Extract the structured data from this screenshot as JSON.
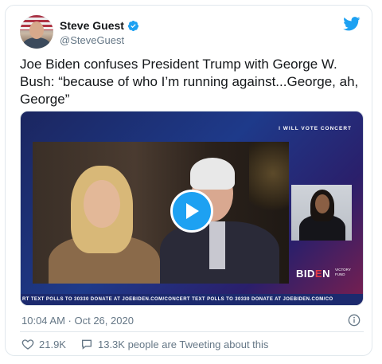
{
  "author": {
    "display_name": "Steve Guest",
    "handle": "@SteveGuest",
    "verified": true
  },
  "tweet": {
    "text": "Joe Biden confuses President Trump with George W. Bush: “because of who I’m running against...George, ah, George”",
    "timestamp": "10:04 AM · Oct 26, 2020"
  },
  "media": {
    "overlay_label": "I WILL VOTE CONCERT",
    "logo_text": "BID",
    "logo_bar": "E",
    "logo_end": "N",
    "logo_sub": "VICTORY FUND",
    "ticker": "RT   TEXT POLLS TO 30330   DONATE AT JOEBIDEN.COM/CONCERT   TEXT POLLS TO 30330   DONATE AT JOEBIDEN.COM/CO"
  },
  "actions": {
    "likes": "21.9K",
    "tweeting": "13.3K people are Tweeting about this"
  },
  "colors": {
    "accent": "#1da1f2",
    "text": "#14171a",
    "muted": "#657786"
  },
  "icons": {
    "brand": "twitter-bird-icon",
    "verified": "verified-badge-icon",
    "play": "play-icon",
    "info": "info-icon",
    "like": "heart-icon",
    "comment": "speech-bubble-icon"
  }
}
